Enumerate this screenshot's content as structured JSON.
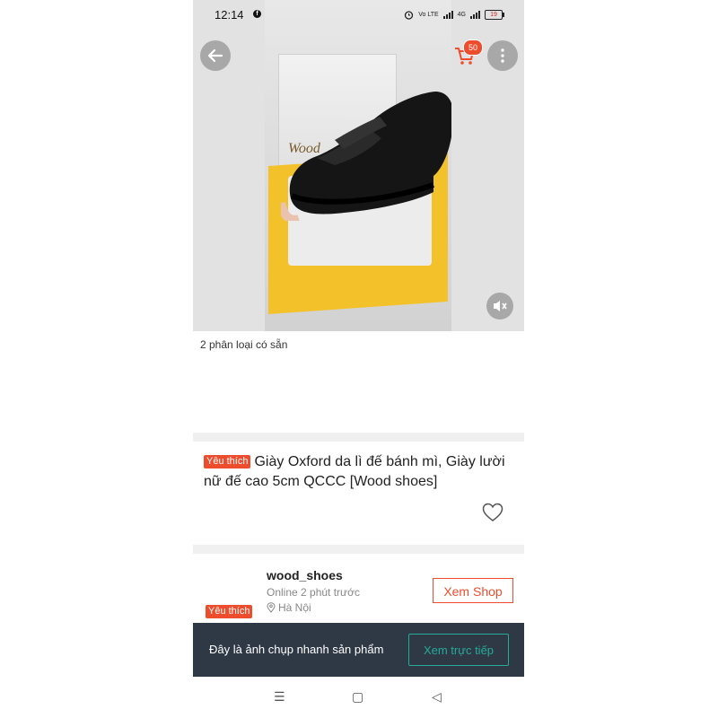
{
  "status_bar": {
    "time": "12:14",
    "network_label": "Vo LTE",
    "signal_label": "4G",
    "battery": "19"
  },
  "media": {
    "box_logo": "Wood",
    "cart_count": "50"
  },
  "product": {
    "variants_text": "2 phân loại có sẵn",
    "favorite_tag": "Yêu thích",
    "title": "Giày Oxford da lì đế bánh mì, Giày lười nữ đế cao 5cm QCCC [Wood shoes]"
  },
  "shop": {
    "name": "wood_shoes",
    "online_status": "Online 2 phút trước",
    "location": "Hà Nội",
    "favorite_tag": "Yêu thích",
    "view_shop_label": "Xem Shop"
  },
  "snapshot_banner": {
    "text": "Đây là ảnh chụp nhanh sản phẩm",
    "view_live_label": "Xem trực tiếp"
  },
  "colors": {
    "accent": "#ee4d2d",
    "banner_bg": "#2f3845",
    "live_button": "#26aa99"
  },
  "icons": [
    "back-arrow-icon",
    "cart-icon",
    "more-vertical-icon",
    "mute-icon",
    "heart-icon",
    "location-pin-icon",
    "menu-nav-icon",
    "home-nav-icon",
    "back-nav-icon"
  ]
}
